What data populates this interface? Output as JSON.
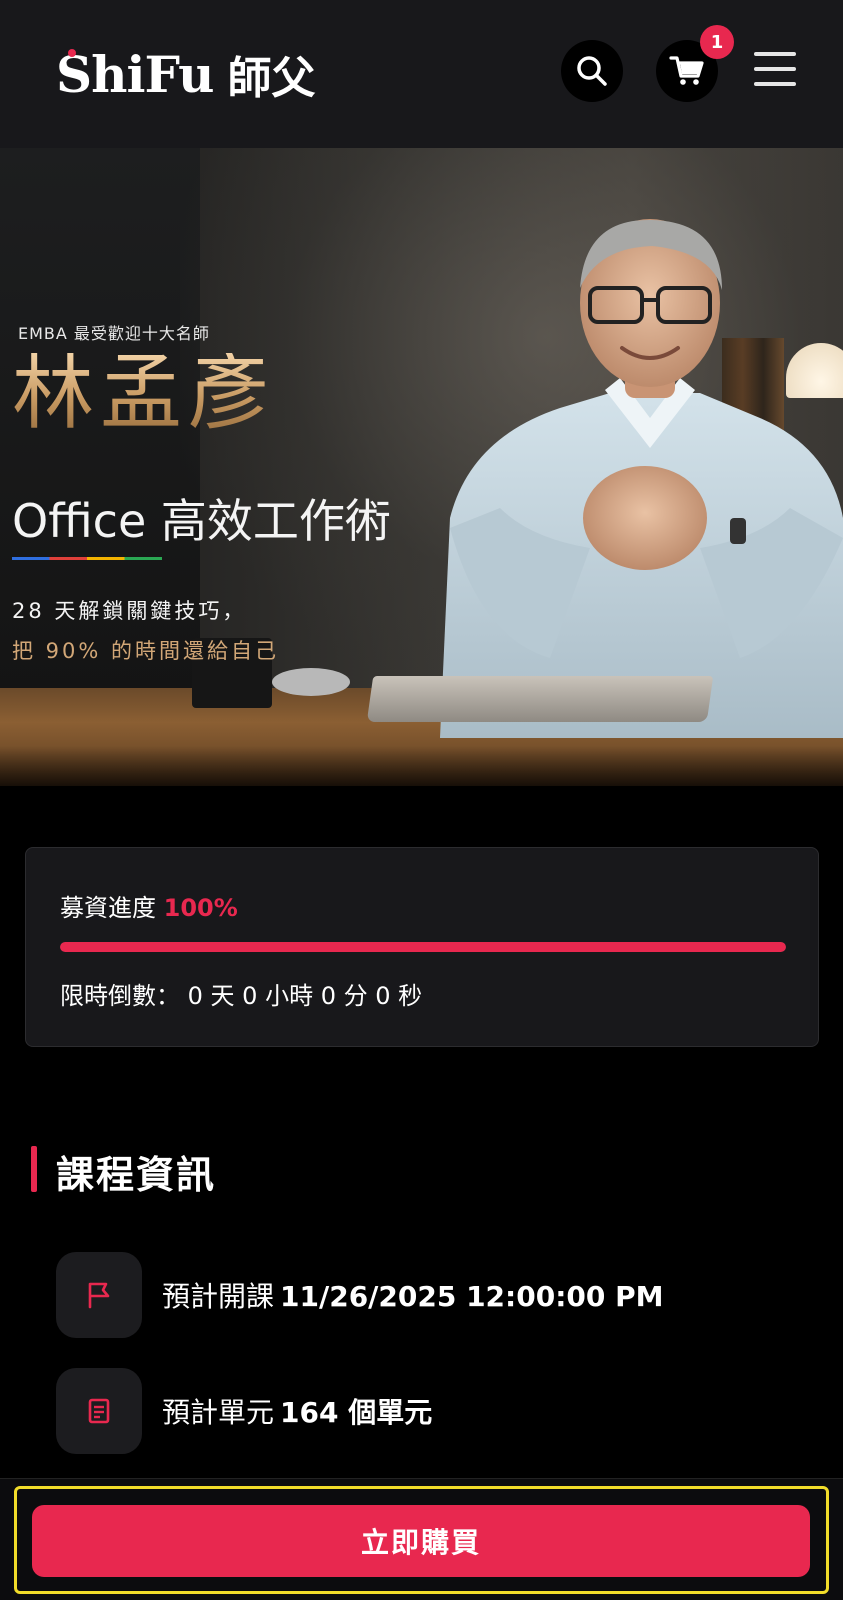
{
  "header": {
    "logo_latin": "ShiFu",
    "logo_cjk": "師父",
    "cart_count": "1",
    "icons": {
      "search": "search-icon",
      "cart": "cart-icon",
      "menu": "menu-icon"
    }
  },
  "hero": {
    "eyebrow": "EMBA 最受歡迎十大名師",
    "name": "林孟彥",
    "course_title": "Office 高效工作術",
    "tagline_1": "28 天解鎖關鍵技巧，",
    "tagline_2": "把 90% 的時間還給自己"
  },
  "funding": {
    "label": "募資進度",
    "percent_text": "100%",
    "progress": 1.0,
    "countdown_label": "限時倒數：",
    "countdown_value": "0 天 0 小時 0 分 0 秒"
  },
  "course_info": {
    "title": "課程資訊",
    "items": [
      {
        "icon": "flag-icon",
        "label": "預計開課",
        "value": "11/26/2025 12:00:00 PM"
      },
      {
        "icon": "document-icon",
        "label": "預計單元",
        "value": "164 個單元"
      }
    ]
  },
  "actions": {
    "buy_label": "立即購買"
  },
  "colors": {
    "accent": "#e8284f",
    "background": "#000000",
    "header_bg": "#18181b",
    "gold": "#d2a777",
    "highlight_outline": "#f2dd2a"
  }
}
